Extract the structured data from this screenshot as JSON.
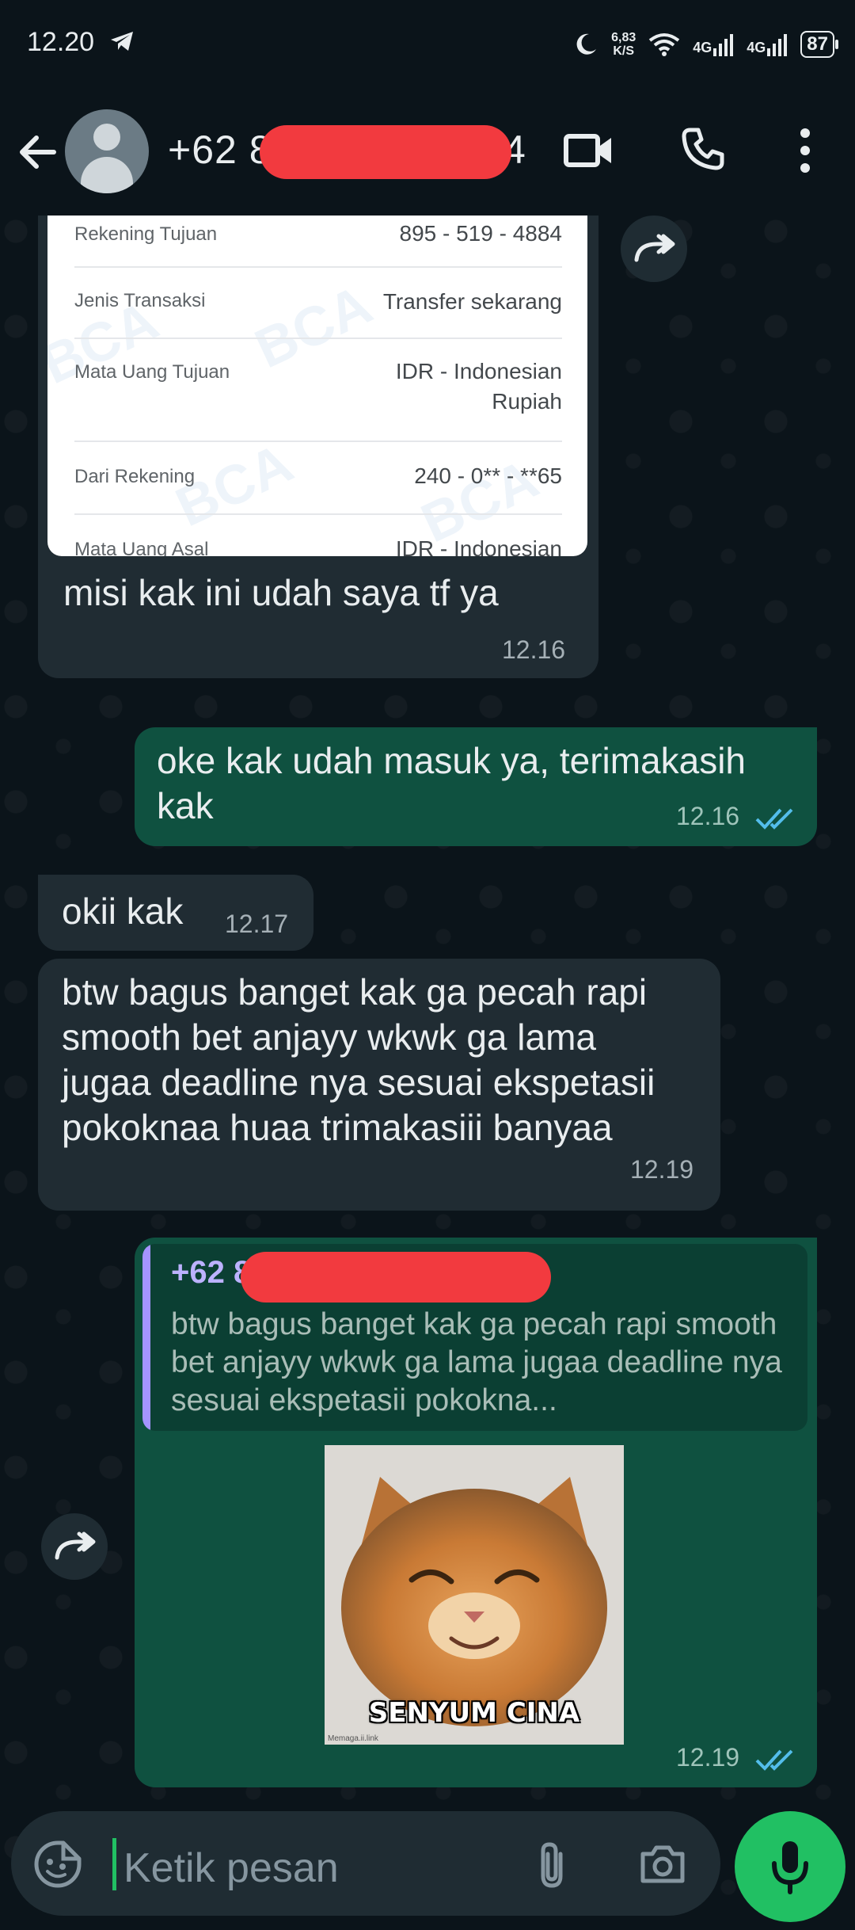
{
  "status": {
    "time": "12.20",
    "speed_value": "6,83",
    "speed_unit": "K/S",
    "net1": "4G",
    "net2": "4G",
    "battery": "87"
  },
  "header": {
    "contact_prefix": "+62 8",
    "contact_suffix": "4"
  },
  "receipt": {
    "rows": [
      {
        "label": "Rekening Tujuan",
        "value": "895 - 519 - 4884"
      },
      {
        "label": "Jenis Transaksi",
        "value": "Transfer sekarang"
      },
      {
        "label": "Mata Uang Tujuan",
        "value": "IDR - Indonesian\nRupiah"
      },
      {
        "label": "Dari Rekening",
        "value": "240 - 0** - **65"
      },
      {
        "label": "Mata Uang Asal",
        "value": "IDR - Indonesian"
      }
    ],
    "watermark": "BCA"
  },
  "messages": [
    {
      "side": "in",
      "text": "misi kak ini udah saya tf ya",
      "time": "12.16"
    },
    {
      "side": "out",
      "text": "oke kak udah masuk ya, terimakasih kak",
      "time": "12.16"
    },
    {
      "side": "in",
      "text": "okii kak",
      "time": "12.17"
    },
    {
      "side": "in",
      "text": "btw bagus banget kak ga pecah rapi smooth bet anjayy wkwk ga lama jugaa deadline nya sesuai ekspetasii pokoknaa huaa trimakasiii banyaa",
      "time": "12.19"
    },
    {
      "side": "out",
      "time": "12.19"
    }
  ],
  "reply_quote": {
    "name": "+62 8",
    "text": "btw bagus banget kak ga pecah rapi smooth bet anjayy wkwk ga lama jugaa deadline nya sesuai ekspetasii pokokna..."
  },
  "sticker": {
    "caption": "SENYUM CINA",
    "credit": "Memaga.ii.link"
  },
  "composer": {
    "placeholder": "Ketik pesan"
  },
  "colors": {
    "background": "#0b141a",
    "incoming_bubble": "#202c33",
    "outgoing_bubble": "#0f5140",
    "accent_green": "#21c063",
    "read_ticks": "#53bdeb",
    "redaction": "#f23a3f"
  }
}
